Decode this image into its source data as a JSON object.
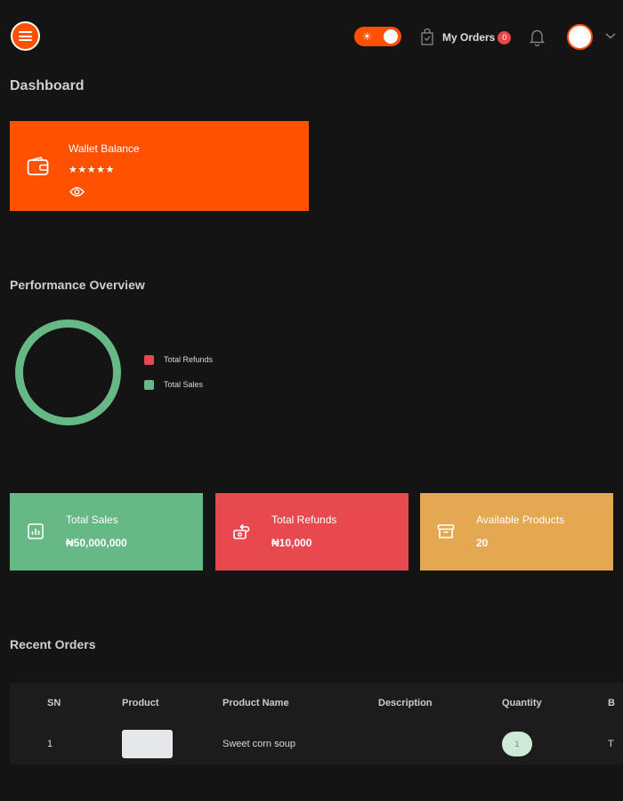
{
  "header": {
    "my_orders_label": "My Orders",
    "orders_badge": "0",
    "theme_toggle_symbol": "☀"
  },
  "page_title": "Dashboard",
  "wallet": {
    "label": "Wallet Balance",
    "masked_value": "★★★★★"
  },
  "performance": {
    "title": "Performance Overview",
    "legend": [
      {
        "label": "Total Refunds",
        "color": "#e8494f"
      },
      {
        "label": "Total Sales",
        "color": "#66b884"
      }
    ]
  },
  "stats": {
    "sales": {
      "label": "Total Sales",
      "value": "₦50,000,000",
      "color": "#66b884"
    },
    "refunds": {
      "label": "Total Refunds",
      "value": "₦10,000",
      "color": "#e8494f"
    },
    "products": {
      "label": "Available Products",
      "value": "20",
      "color": "#e5a852"
    }
  },
  "recent_orders": {
    "title": "Recent Orders",
    "columns": [
      "SN",
      "Product",
      "Product Name",
      "Description",
      "Quantity",
      "B"
    ],
    "rows": [
      {
        "sn": "1",
        "product_name": "Sweet corn soup",
        "description": "",
        "quantity": "1",
        "last": "T"
      }
    ]
  },
  "colors": {
    "accent": "#ff5100",
    "background": "#141414"
  },
  "icons": {
    "menu": "menu-icon",
    "bag": "shopping-bag-icon",
    "bell": "bell-icon",
    "wallet": "wallet-icon",
    "eye": "eye-icon",
    "chart": "bar-chart-icon",
    "refund": "refund-icon",
    "archive": "archive-box-icon"
  }
}
